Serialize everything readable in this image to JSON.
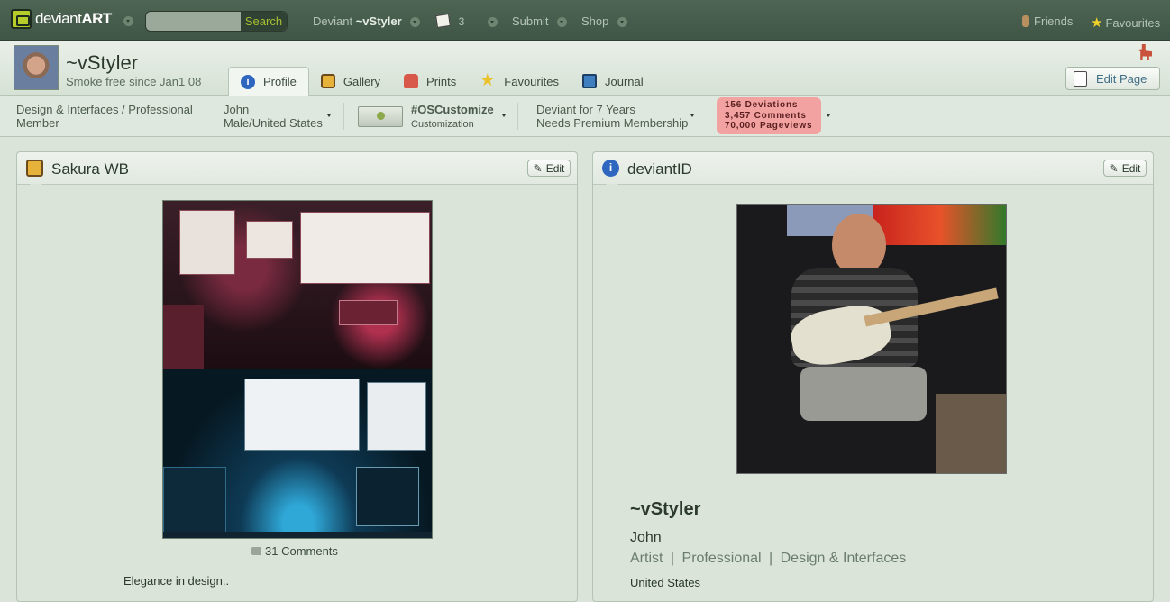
{
  "topbar": {
    "logo_text": "deviant",
    "logo_bold": "ART",
    "search_placeholder": "",
    "search_button": "Search",
    "deviant_label": "Deviant",
    "deviant_name": "~vStyler",
    "messages_count": "3",
    "submit_label": "Submit",
    "shop_label": "Shop",
    "friends_label": "Friends",
    "favourites_label": "Favourites"
  },
  "profile": {
    "username": "~vStyler",
    "tagline": "Smoke free since Jan1 08",
    "tabs": [
      {
        "label": "Profile",
        "icon": "info-icon"
      },
      {
        "label": "Gallery",
        "icon": "gallery-icon"
      },
      {
        "label": "Prints",
        "icon": "prints-icon"
      },
      {
        "label": "Favourites",
        "icon": "star-icon"
      },
      {
        "label": "Journal",
        "icon": "journal-icon"
      }
    ],
    "edit_page_label": "Edit Page"
  },
  "infobar": {
    "category_line1": "Design & Interfaces / Professional",
    "category_line2": "Member",
    "name": "John",
    "location": "Male/United States",
    "group_name": "#OSCustomize",
    "group_sub": "Customization",
    "deviant_for": "Deviant for 7 Years",
    "membership": "Needs Premium Membership",
    "stats": {
      "deviations": "156 Deviations",
      "comments": "3,457 Comments",
      "pageviews": "70,000 Pageviews"
    }
  },
  "left_panel": {
    "title": "Sakura WB",
    "edit_label": "Edit",
    "comments": "31 Comments",
    "description": "Elegance in design.."
  },
  "right_panel": {
    "title": "deviantID",
    "edit_label": "Edit",
    "username": "~vStyler",
    "real_name": "John",
    "roles": [
      "Artist",
      "Professional",
      "Design & Interfaces"
    ],
    "role_separator": "|",
    "country": "United States"
  },
  "colors": {
    "topbar": "#465c4b",
    "accent_green": "#b6cc2a",
    "stats_bg": "#f2a2a0",
    "link": "#3f6e86"
  }
}
